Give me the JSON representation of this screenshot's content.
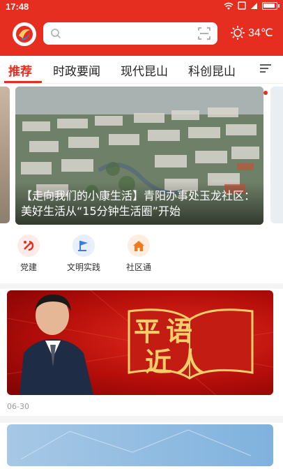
{
  "status": {
    "time": "17:48"
  },
  "search": {
    "placeholder": ""
  },
  "weather": {
    "temp": "34℃"
  },
  "tabs": [
    {
      "label": "推荐"
    },
    {
      "label": "时政要闻"
    },
    {
      "label": "现代昆山"
    },
    {
      "label": "科创昆山"
    }
  ],
  "carousel": {
    "caption": "【走向我们的小康生活】青阳办事处玉龙社区：美好生活从“15分钟生活圈”开始"
  },
  "quick_links": [
    {
      "label": "党建",
      "icon": "party-flag-icon",
      "color": "#e62e20"
    },
    {
      "label": "文明实践",
      "icon": "flag-icon",
      "color": "#3b7ddd"
    },
    {
      "label": "社区通",
      "icon": "house-icon",
      "color": "#f27a1a"
    }
  ],
  "banner": {
    "title_top": "平语",
    "title_bottom": "近人"
  },
  "feed": {
    "date": "06-30"
  },
  "colors": {
    "brand": "#e62e20",
    "accent_gold": "#f6cf6b"
  }
}
